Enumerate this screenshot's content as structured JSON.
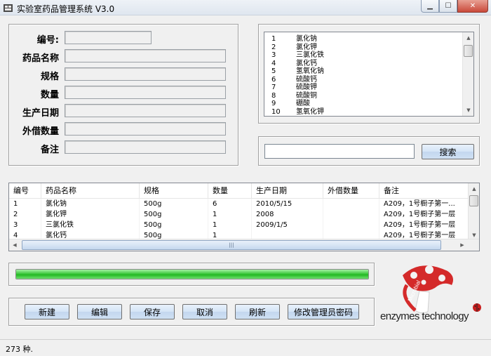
{
  "window": {
    "title": "实验室药品管理系统 V3.0"
  },
  "form": {
    "labels": [
      "编号:",
      "药品名称",
      "规格",
      "数量",
      "生产日期",
      "外借数量",
      "备注"
    ]
  },
  "drug_list": [
    {
      "num": "1",
      "name": "氯化钠"
    },
    {
      "num": "2",
      "name": "氯化钾"
    },
    {
      "num": "3",
      "name": "三氯化铁"
    },
    {
      "num": "4",
      "name": "氯化钙"
    },
    {
      "num": "5",
      "name": "氢氧化钠"
    },
    {
      "num": "6",
      "name": "硫酸钙"
    },
    {
      "num": "7",
      "name": "硫酸钾"
    },
    {
      "num": "8",
      "name": "硫酸铜"
    },
    {
      "num": "9",
      "name": "硼酸"
    },
    {
      "num": "10",
      "name": "氢氧化钾"
    }
  ],
  "search": {
    "button_label": "搜索",
    "value": ""
  },
  "table": {
    "headers": [
      "编号",
      "药品名称",
      "规格",
      "数量",
      "生产日期",
      "外借数量",
      "备注"
    ],
    "rows": [
      [
        "1",
        "氯化钠",
        "500g",
        "6",
        "2010/5/15",
        "",
        "A209，1号橱子第一..."
      ],
      [
        "2",
        "氯化钾",
        "500g",
        "1",
        "2008",
        "",
        "A209，1号橱子第一层"
      ],
      [
        "3",
        "三氯化铁",
        "500g",
        "1",
        "2009/1/5",
        "",
        "A209，1号橱子第一层"
      ],
      [
        "4",
        "氯化钙",
        "500g",
        "1",
        "",
        "",
        "A209，1号橱子第一层"
      ]
    ]
  },
  "progress": {
    "percent": 100,
    "color": "#2fc02f"
  },
  "toolbar": {
    "new": "新建",
    "edit": "编辑",
    "save": "保存",
    "cancel": "取消",
    "refresh": "刷新",
    "change_password": "修改管理员密码"
  },
  "logo": {
    "text": "enzymes technology",
    "sub": "Microbial",
    "color": "#d42a2a"
  },
  "status": {
    "text": "273 种."
  }
}
